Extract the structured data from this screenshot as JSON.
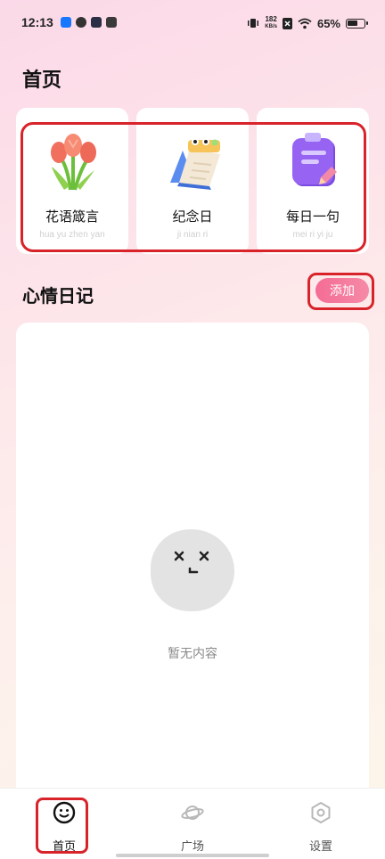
{
  "status_bar": {
    "time": "12:13",
    "net_speed_value": "182",
    "net_speed_unit": "KB/s",
    "battery": "65%"
  },
  "page": {
    "title": "首页"
  },
  "feature_cards": [
    {
      "label": "花语箴言",
      "pinyin": "hua yu zhen yan",
      "icon": "tulip-bouquet-icon"
    },
    {
      "label": "纪念日",
      "pinyin": "ji nian ri",
      "icon": "desk-calendar-icon"
    },
    {
      "label": "每日一句",
      "pinyin": "mei ri yi ju",
      "icon": "notepad-pen-icon"
    }
  ],
  "diary": {
    "title": "心情日记",
    "add_label": "添加",
    "empty_text": "暂无内容"
  },
  "tab_bar": {
    "tabs": [
      {
        "label": "首页",
        "icon": "smiley-icon",
        "active": true
      },
      {
        "label": "广场",
        "icon": "planet-icon",
        "active": false
      },
      {
        "label": "设置",
        "icon": "settings-hexagon-icon",
        "active": false
      }
    ]
  },
  "colors": {
    "accent": "#f56c95",
    "highlight_outline": "#d8232a",
    "inactive_icon": "#b8b8b8"
  }
}
